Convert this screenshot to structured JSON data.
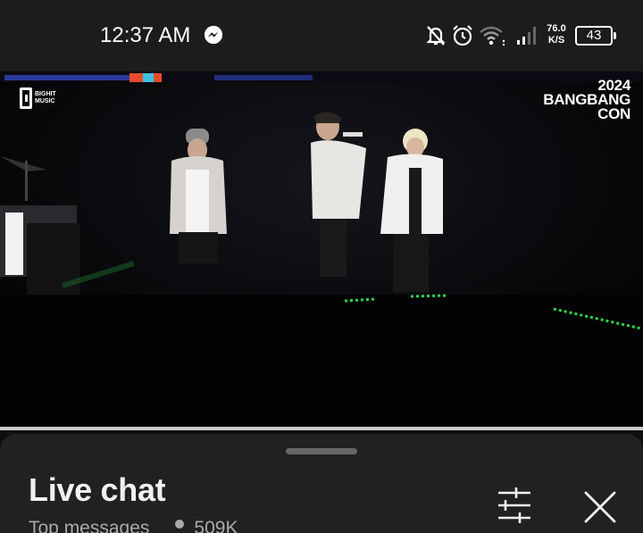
{
  "status_bar": {
    "time": "12:37 AM",
    "notification_app_icon": "messenger-icon",
    "icons": [
      "notifications-off-icon",
      "alarm-icon",
      "wifi-icon",
      "cellular-signal-icon"
    ],
    "net_speed_value": "76.0",
    "net_speed_unit": "K/S",
    "battery_level": "43"
  },
  "video": {
    "channel_logo_text": "BIGHIT MUSIC",
    "event_title_line1": "2024",
    "event_title_line2": "BANGBANG",
    "event_title_line3": "CON",
    "progress_fraction": 1.0
  },
  "chat": {
    "title": "Live chat",
    "mode_label": "Top messages",
    "viewer_count": "509K",
    "filter_icon": "sliders-icon",
    "close_icon": "close-icon"
  },
  "colors": {
    "status_bar_bg": "#1c1c1c",
    "sheet_bg": "#212121",
    "stage_light_green": "#2fd34a"
  }
}
